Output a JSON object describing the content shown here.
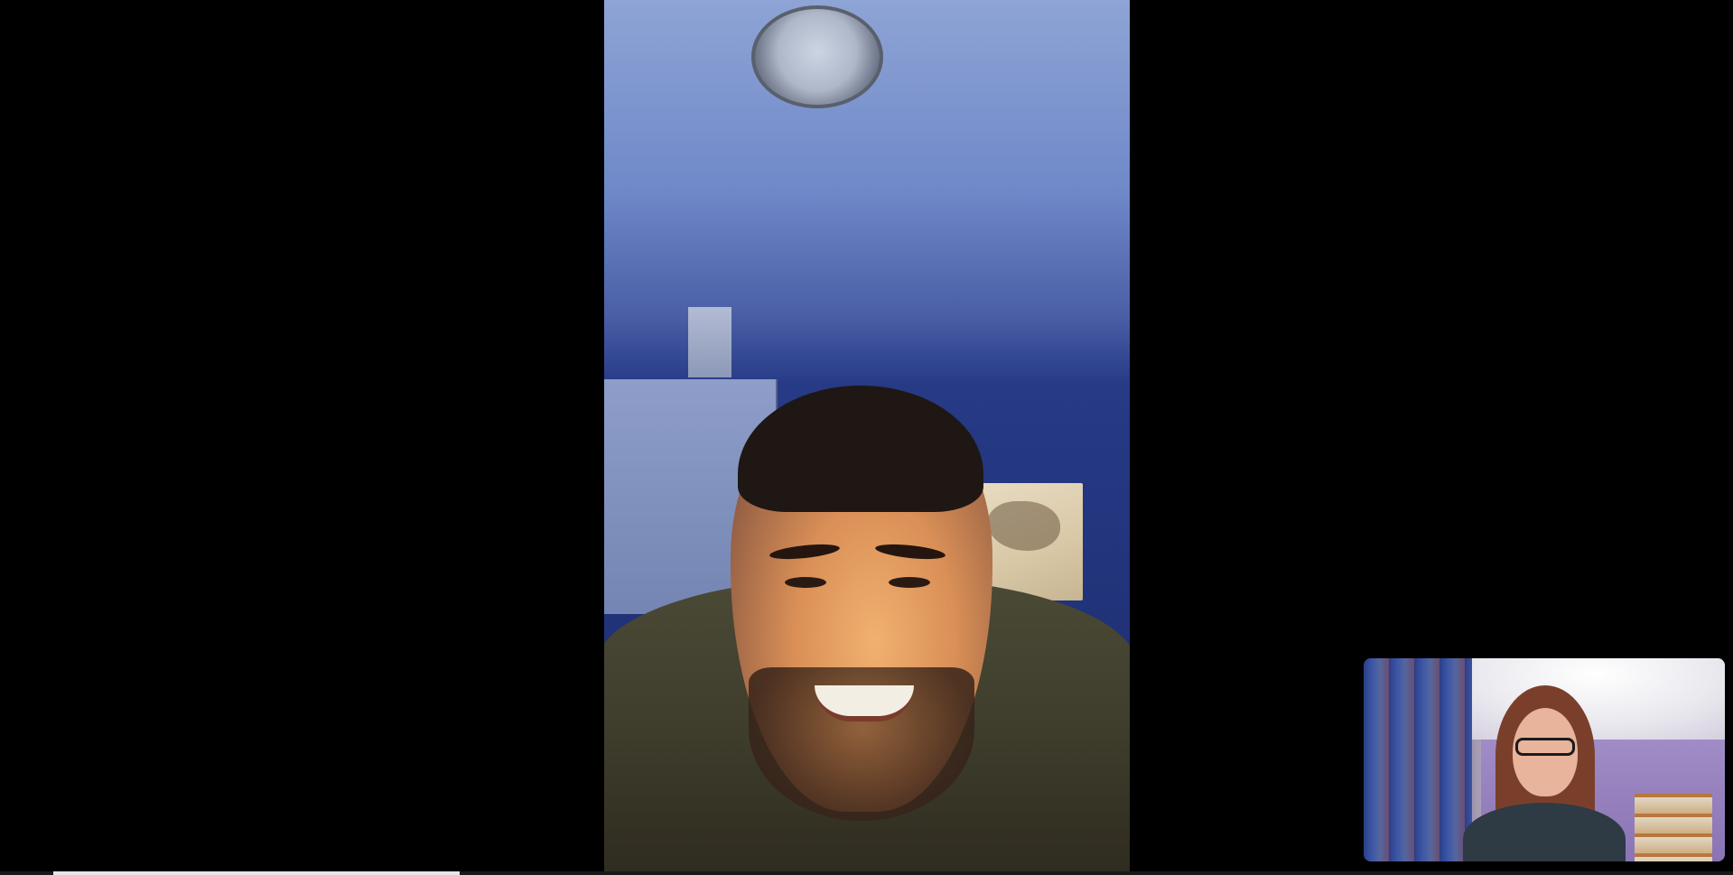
{
  "call": {
    "remote_participant_feed": "remote-video",
    "self_view_feed": "self-view"
  },
  "playback": {
    "buffered_start_fraction": 0.031,
    "buffered_fraction": 0.2344
  },
  "colors": {
    "background": "#000000",
    "remote_shirt": "#4b4a36",
    "progress_fill": "#e6e6e6"
  }
}
